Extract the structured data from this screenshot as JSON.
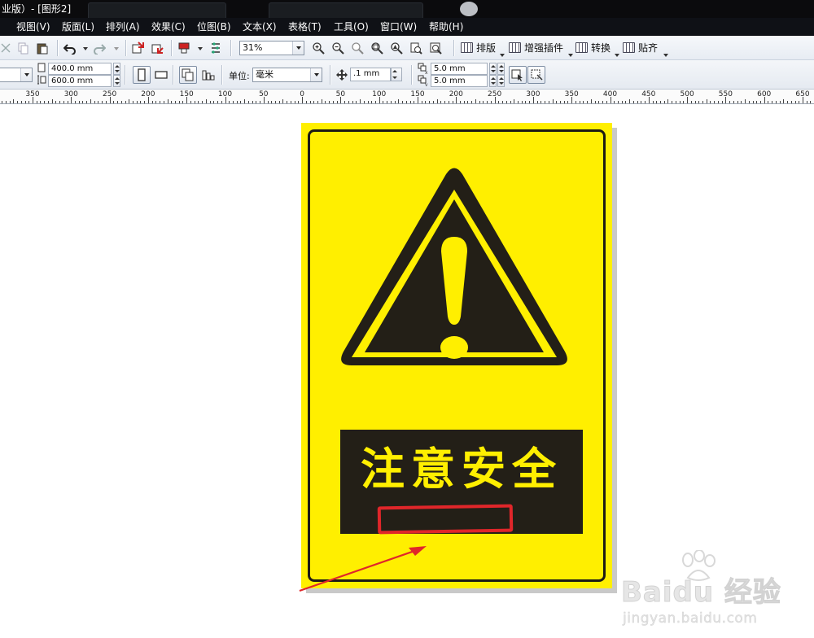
{
  "window": {
    "title": "业版）- [图形2]"
  },
  "menu": [
    {
      "key": "view",
      "label": "视图(V)"
    },
    {
      "key": "layout",
      "label": "版面(L)"
    },
    {
      "key": "arrange",
      "label": "排列(A)"
    },
    {
      "key": "effects",
      "label": "效果(C)"
    },
    {
      "key": "bitmaps",
      "label": "位图(B)"
    },
    {
      "key": "text",
      "label": "文本(X)"
    },
    {
      "key": "table",
      "label": "表格(T)"
    },
    {
      "key": "tools",
      "label": "工具(O)"
    },
    {
      "key": "window",
      "label": "窗口(W)"
    },
    {
      "key": "help",
      "label": "帮助(H)"
    }
  ],
  "toolbar": {
    "zoom": "31%",
    "buttons": [
      {
        "key": "layout",
        "label": "排版"
      },
      {
        "key": "plugins",
        "label": "增强插件"
      },
      {
        "key": "convert",
        "label": "转换"
      },
      {
        "key": "snap",
        "label": "贴齐"
      }
    ]
  },
  "property_bar": {
    "page_width": "400.0 mm",
    "page_height": "600.0 mm",
    "units_label": "单位:",
    "units_value": "毫米",
    "nudge": ".1 mm",
    "dup_x": "5.0 mm",
    "dup_y": "5.0 mm"
  },
  "ruler": {
    "labels": [
      "350",
      "300",
      "250",
      "200",
      "150",
      "100",
      "50",
      "0",
      "50",
      "100",
      "150",
      "200",
      "250",
      "300",
      "350",
      "400",
      "450",
      "500",
      "550",
      "600",
      "650"
    ]
  },
  "sign": {
    "title": "注意安全",
    "background_color": "#ffef00",
    "plate_color": "#231f17",
    "highlight_color": "#e0262a"
  },
  "watermark": {
    "brand": "Bai",
    "brand_suffix": "du",
    "brand_cn": "经验",
    "url": "jingyan.baidu.com"
  }
}
